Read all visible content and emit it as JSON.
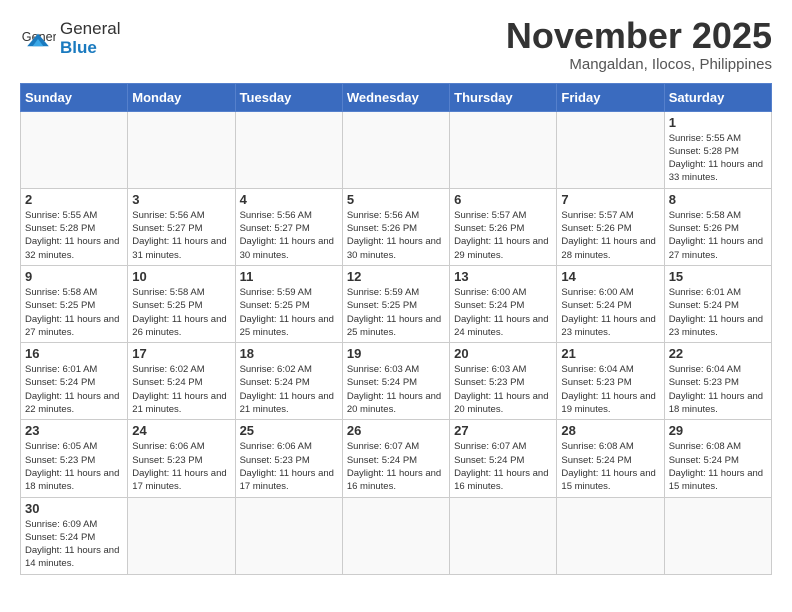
{
  "header": {
    "logo_text_normal": "General",
    "logo_text_bold": "Blue",
    "month_title": "November 2025",
    "location": "Mangaldan, Ilocos, Philippines"
  },
  "weekdays": [
    "Sunday",
    "Monday",
    "Tuesday",
    "Wednesday",
    "Thursday",
    "Friday",
    "Saturday"
  ],
  "days": [
    {
      "date": null,
      "num": "",
      "sunrise": "",
      "sunset": "",
      "daylight": ""
    },
    {
      "date": null,
      "num": "",
      "sunrise": "",
      "sunset": "",
      "daylight": ""
    },
    {
      "date": null,
      "num": "",
      "sunrise": "",
      "sunset": "",
      "daylight": ""
    },
    {
      "date": null,
      "num": "",
      "sunrise": "",
      "sunset": "",
      "daylight": ""
    },
    {
      "date": null,
      "num": "",
      "sunrise": "",
      "sunset": "",
      "daylight": ""
    },
    {
      "date": null,
      "num": "",
      "sunrise": "",
      "sunset": "",
      "daylight": ""
    },
    {
      "num": "1",
      "sunrise": "Sunrise: 5:55 AM",
      "sunset": "Sunset: 5:28 PM",
      "daylight": "Daylight: 11 hours and 33 minutes."
    },
    {
      "num": "2",
      "sunrise": "Sunrise: 5:55 AM",
      "sunset": "Sunset: 5:28 PM",
      "daylight": "Daylight: 11 hours and 32 minutes."
    },
    {
      "num": "3",
      "sunrise": "Sunrise: 5:56 AM",
      "sunset": "Sunset: 5:27 PM",
      "daylight": "Daylight: 11 hours and 31 minutes."
    },
    {
      "num": "4",
      "sunrise": "Sunrise: 5:56 AM",
      "sunset": "Sunset: 5:27 PM",
      "daylight": "Daylight: 11 hours and 30 minutes."
    },
    {
      "num": "5",
      "sunrise": "Sunrise: 5:56 AM",
      "sunset": "Sunset: 5:26 PM",
      "daylight": "Daylight: 11 hours and 30 minutes."
    },
    {
      "num": "6",
      "sunrise": "Sunrise: 5:57 AM",
      "sunset": "Sunset: 5:26 PM",
      "daylight": "Daylight: 11 hours and 29 minutes."
    },
    {
      "num": "7",
      "sunrise": "Sunrise: 5:57 AM",
      "sunset": "Sunset: 5:26 PM",
      "daylight": "Daylight: 11 hours and 28 minutes."
    },
    {
      "num": "8",
      "sunrise": "Sunrise: 5:58 AM",
      "sunset": "Sunset: 5:26 PM",
      "daylight": "Daylight: 11 hours and 27 minutes."
    },
    {
      "num": "9",
      "sunrise": "Sunrise: 5:58 AM",
      "sunset": "Sunset: 5:25 PM",
      "daylight": "Daylight: 11 hours and 27 minutes."
    },
    {
      "num": "10",
      "sunrise": "Sunrise: 5:58 AM",
      "sunset": "Sunset: 5:25 PM",
      "daylight": "Daylight: 11 hours and 26 minutes."
    },
    {
      "num": "11",
      "sunrise": "Sunrise: 5:59 AM",
      "sunset": "Sunset: 5:25 PM",
      "daylight": "Daylight: 11 hours and 25 minutes."
    },
    {
      "num": "12",
      "sunrise": "Sunrise: 5:59 AM",
      "sunset": "Sunset: 5:25 PM",
      "daylight": "Daylight: 11 hours and 25 minutes."
    },
    {
      "num": "13",
      "sunrise": "Sunrise: 6:00 AM",
      "sunset": "Sunset: 5:24 PM",
      "daylight": "Daylight: 11 hours and 24 minutes."
    },
    {
      "num": "14",
      "sunrise": "Sunrise: 6:00 AM",
      "sunset": "Sunset: 5:24 PM",
      "daylight": "Daylight: 11 hours and 23 minutes."
    },
    {
      "num": "15",
      "sunrise": "Sunrise: 6:01 AM",
      "sunset": "Sunset: 5:24 PM",
      "daylight": "Daylight: 11 hours and 23 minutes."
    },
    {
      "num": "16",
      "sunrise": "Sunrise: 6:01 AM",
      "sunset": "Sunset: 5:24 PM",
      "daylight": "Daylight: 11 hours and 22 minutes."
    },
    {
      "num": "17",
      "sunrise": "Sunrise: 6:02 AM",
      "sunset": "Sunset: 5:24 PM",
      "daylight": "Daylight: 11 hours and 21 minutes."
    },
    {
      "num": "18",
      "sunrise": "Sunrise: 6:02 AM",
      "sunset": "Sunset: 5:24 PM",
      "daylight": "Daylight: 11 hours and 21 minutes."
    },
    {
      "num": "19",
      "sunrise": "Sunrise: 6:03 AM",
      "sunset": "Sunset: 5:24 PM",
      "daylight": "Daylight: 11 hours and 20 minutes."
    },
    {
      "num": "20",
      "sunrise": "Sunrise: 6:03 AM",
      "sunset": "Sunset: 5:23 PM",
      "daylight": "Daylight: 11 hours and 20 minutes."
    },
    {
      "num": "21",
      "sunrise": "Sunrise: 6:04 AM",
      "sunset": "Sunset: 5:23 PM",
      "daylight": "Daylight: 11 hours and 19 minutes."
    },
    {
      "num": "22",
      "sunrise": "Sunrise: 6:04 AM",
      "sunset": "Sunset: 5:23 PM",
      "daylight": "Daylight: 11 hours and 18 minutes."
    },
    {
      "num": "23",
      "sunrise": "Sunrise: 6:05 AM",
      "sunset": "Sunset: 5:23 PM",
      "daylight": "Daylight: 11 hours and 18 minutes."
    },
    {
      "num": "24",
      "sunrise": "Sunrise: 6:06 AM",
      "sunset": "Sunset: 5:23 PM",
      "daylight": "Daylight: 11 hours and 17 minutes."
    },
    {
      "num": "25",
      "sunrise": "Sunrise: 6:06 AM",
      "sunset": "Sunset: 5:23 PM",
      "daylight": "Daylight: 11 hours and 17 minutes."
    },
    {
      "num": "26",
      "sunrise": "Sunrise: 6:07 AM",
      "sunset": "Sunset: 5:24 PM",
      "daylight": "Daylight: 11 hours and 16 minutes."
    },
    {
      "num": "27",
      "sunrise": "Sunrise: 6:07 AM",
      "sunset": "Sunset: 5:24 PM",
      "daylight": "Daylight: 11 hours and 16 minutes."
    },
    {
      "num": "28",
      "sunrise": "Sunrise: 6:08 AM",
      "sunset": "Sunset: 5:24 PM",
      "daylight": "Daylight: 11 hours and 15 minutes."
    },
    {
      "num": "29",
      "sunrise": "Sunrise: 6:08 AM",
      "sunset": "Sunset: 5:24 PM",
      "daylight": "Daylight: 11 hours and 15 minutes."
    },
    {
      "num": "30",
      "sunrise": "Sunrise: 6:09 AM",
      "sunset": "Sunset: 5:24 PM",
      "daylight": "Daylight: 11 hours and 14 minutes."
    }
  ],
  "colors": {
    "header_bg": "#3a6bbf",
    "header_text": "#ffffff",
    "border": "#cccccc"
  }
}
